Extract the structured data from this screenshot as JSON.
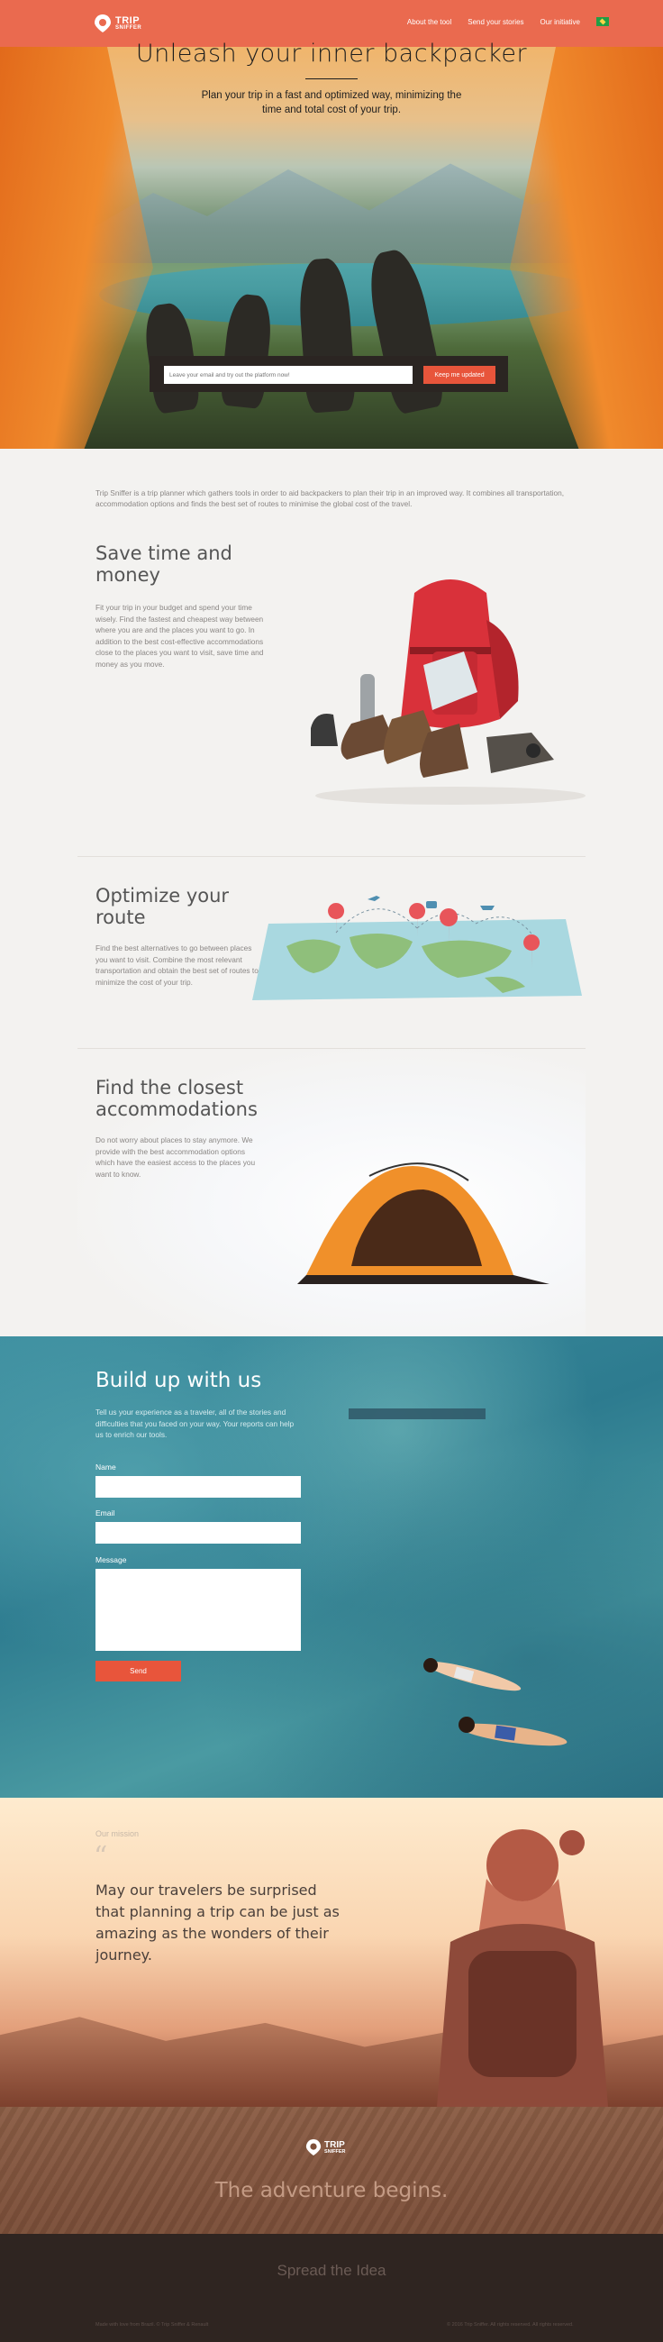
{
  "header": {
    "logo_text_line1": "TRIP",
    "logo_text_line2": "SNIFFER",
    "nav": [
      "About the tool",
      "Send your stories",
      "Our initiative"
    ],
    "flag_icon": "brazil-flag-icon",
    "bg_color": "#ea6a4f"
  },
  "hero": {
    "title": "Unleash your inner backpacker",
    "subtitle": "Plan your trip in a fast and optimized way, minimizing the time and total cost of your trip.",
    "email_placeholder": "Leave your email and try out the platform now!",
    "cta_label": "Keep me updated"
  },
  "intro": {
    "text": "Trip Sniffer is a trip planner which gathers tools in order to aid backpackers to plan their trip in an improved way. It combines all transportation, accommodation options and finds the best set of routes to minimise the global cost of the travel."
  },
  "features": [
    {
      "title": "Save time and money",
      "text": "Fit your trip in your budget and spend your time wisely. Find the fastest and cheapest way between where you are and the places you want to go. In addition to the best cost-effective accommodations close to the places you want to visit, save time and money as you move."
    },
    {
      "title": "Optimize your route",
      "text": "Find the best alternatives to go between places you want to visit. Combine the most relevant transportation and obtain the best set of routes to minimize the cost of your trip."
    },
    {
      "title": "Find the closest accommodations",
      "text": "Do not worry about places to stay anymore. We provide with the best accommodation options which have the easiest access to the places you want to know."
    }
  ],
  "build": {
    "title": "Build up with us",
    "text": "Tell us your experience as a traveler, all of the stories and difficulties that you faced on your way. Your reports can help us to enrich our tools.",
    "name_label": "Name",
    "email_label": "Email",
    "message_label": "Message",
    "send_label": "Send"
  },
  "mission": {
    "label": "Our mission",
    "quote_mark": "“",
    "quote": "May our travelers be surprised that planning a trip can be just as amazing as the wonders of their journey."
  },
  "footer": {
    "tagline": "The adventure begins.",
    "spread": "Spread the Idea",
    "copy_left": "Made with love from Brazil. © Trip Sniffer & Renault",
    "copy_right": "© 2016 Trip Sniffer. All rights reserved. All rights reserved."
  },
  "colors": {
    "accent": "#e8553b",
    "text": "#555555",
    "muted": "#8a8684"
  }
}
